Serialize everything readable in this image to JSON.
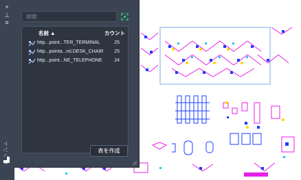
{
  "palette": {
    "close_glyph": "×",
    "pin_glyph": "⊥",
    "settings_glyph": "≡",
    "title_vertical": "カウント"
  },
  "search": {
    "placeholder": "検索",
    "value": ""
  },
  "table": {
    "col_name": "名前 ▲",
    "col_count": "カウント",
    "rows": [
      {
        "name": "http...point...TER_TERMINAL",
        "count": "25"
      },
      {
        "name": "http...pointa...ml.DESK_CHAIR",
        "count": "25"
      },
      {
        "name": "http...point...NE_TELEPHONE",
        "count": "24"
      }
    ]
  },
  "create_button": "表を作成",
  "colors": {
    "panel": "#3b4453",
    "accent_green": "#35c27a",
    "cad_magenta": "#e81fe8",
    "cad_blue": "#1e3cff"
  }
}
